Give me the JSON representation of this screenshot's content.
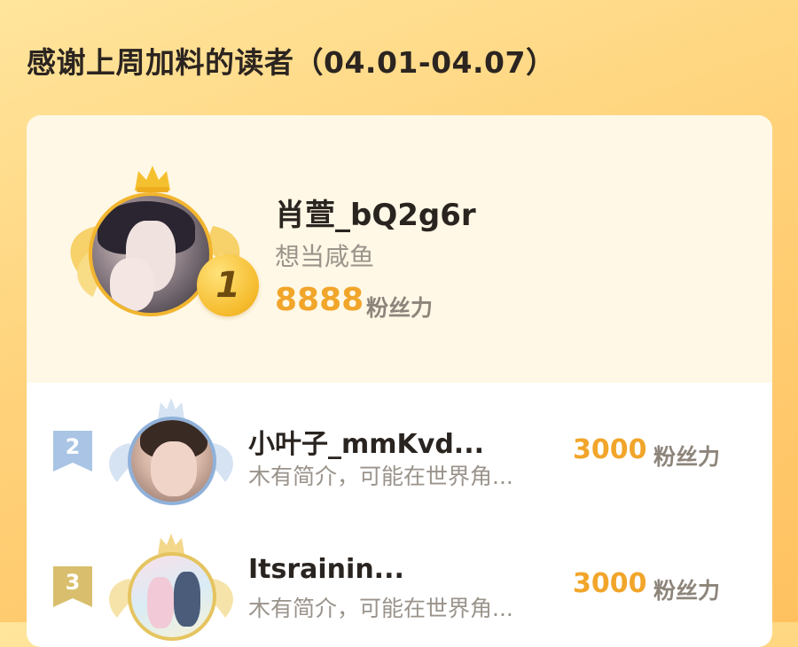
{
  "header": {
    "title": "感谢上周加料的读者（04.01-04.07）"
  },
  "colors": {
    "accent_orange": "#f1a52a",
    "gold": "#f2b52f",
    "silver_blue": "#8fb1d9",
    "bronze_gold": "#e5c460"
  },
  "ranking": {
    "first": {
      "rank": "1",
      "name": "肖萱_bQ2g6r",
      "bio": "想当咸鱼",
      "fans_value": "8888",
      "fans_label": "粉丝力"
    },
    "rows": [
      {
        "rank": "2",
        "name": "小叶子_mmKvd...",
        "bio": "木有简介，可能在世界角...",
        "fans_value": "3000",
        "fans_label": "粉丝力"
      },
      {
        "rank": "3",
        "name": "Itsrainin...",
        "bio": "木有简介，可能在世界角...",
        "fans_value": "3000",
        "fans_label": "粉丝力"
      }
    ]
  }
}
